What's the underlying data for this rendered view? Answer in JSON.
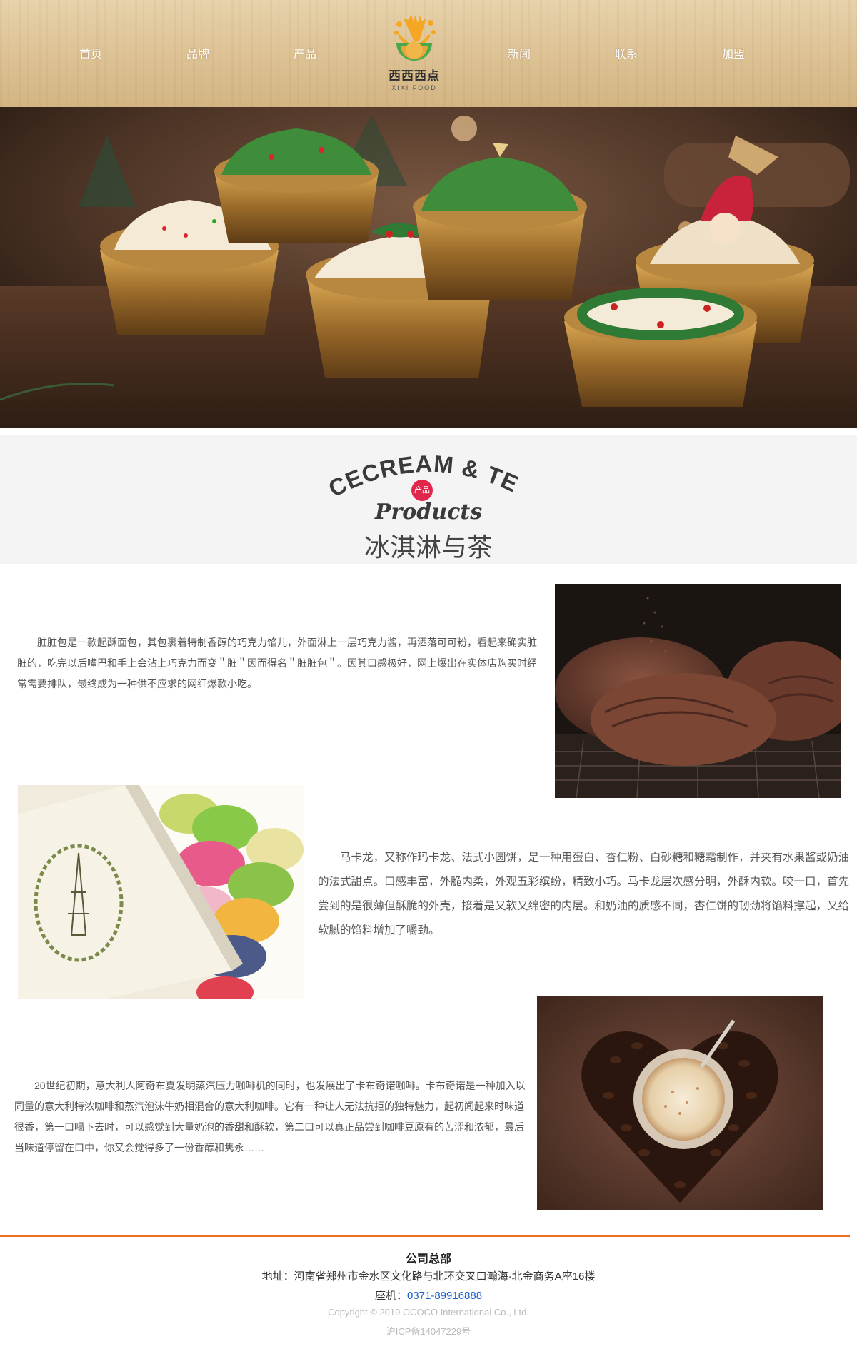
{
  "nav": {
    "items": [
      {
        "label": "首页"
      },
      {
        "label": "品牌"
      },
      {
        "label": "产品"
      },
      {
        "label": "新闻"
      },
      {
        "label": "联系"
      },
      {
        "label": "加盟"
      }
    ]
  },
  "logo": {
    "name_cn": "西西西点",
    "name_en": "XIXI FOOD"
  },
  "section": {
    "heading_en": "ICECREAM & TEA",
    "badge": "产品",
    "script": "Products",
    "heading_cn": "冰淇淋与茶"
  },
  "products": [
    {
      "text": "脏脏包是一款起酥面包，其包裹着特制香醇的巧克力馅儿，外面淋上一层巧克力酱，再洒落可可粉，看起来确实脏脏的，吃完以后嘴巴和手上会沾上巧克力而变＂脏＂因而得名＂脏脏包＂。因其口感极好，网上爆出在实体店购买时经常需要排队，最终成为一种供不应求的网红爆款小吃。"
    },
    {
      "text": "马卡龙，又称作玛卡龙、法式小圆饼，是一种用蛋白、杏仁粉、白砂糖和糖霜制作，并夹有水果酱或奶油的法式甜点。口感丰富，外脆内柔，外观五彩缤纷，精致小巧。马卡龙层次感分明，外酥内软。咬一口，首先尝到的是很薄但酥脆的外壳，接着是又软又绵密的内层。和奶油的质感不同，杏仁饼的韧劲将馅料撑起，又给软腻的馅料增加了嚼劲。"
    },
    {
      "text": "20世纪初期，意大利人阿奇布夏发明蒸汽压力咖啡机的同时，也发展出了卡布奇诺咖啡。卡布奇诺是一种加入以同量的意大利特浓咖啡和蒸汽泡沫牛奶相混合的意大利咖啡。它有一种让人无法抗拒的独特魅力，起初闻起来时味道很香，第一口喝下去时，可以感觉到大量奶泡的香甜和酥软，第二口可以真正品尝到咖啡豆原有的苦涩和浓郁，最后当味道停留在口中，你又会觉得多了一份香醇和隽永……"
    }
  ],
  "footer": {
    "title": "公司总部",
    "address": "地址：河南省郑州市金水区文化路与北环交叉口瀚海·北金商务A座16楼",
    "phone_label": "座机：",
    "phone": "0371-89916888",
    "copyright": "Copyright © 2019 OCOCO International Co., Ltd.",
    "icp": "沪ICP备14047229号"
  },
  "colors": {
    "accent": "#f07020",
    "badge": "#e2254b",
    "link": "#1a5fcf"
  }
}
